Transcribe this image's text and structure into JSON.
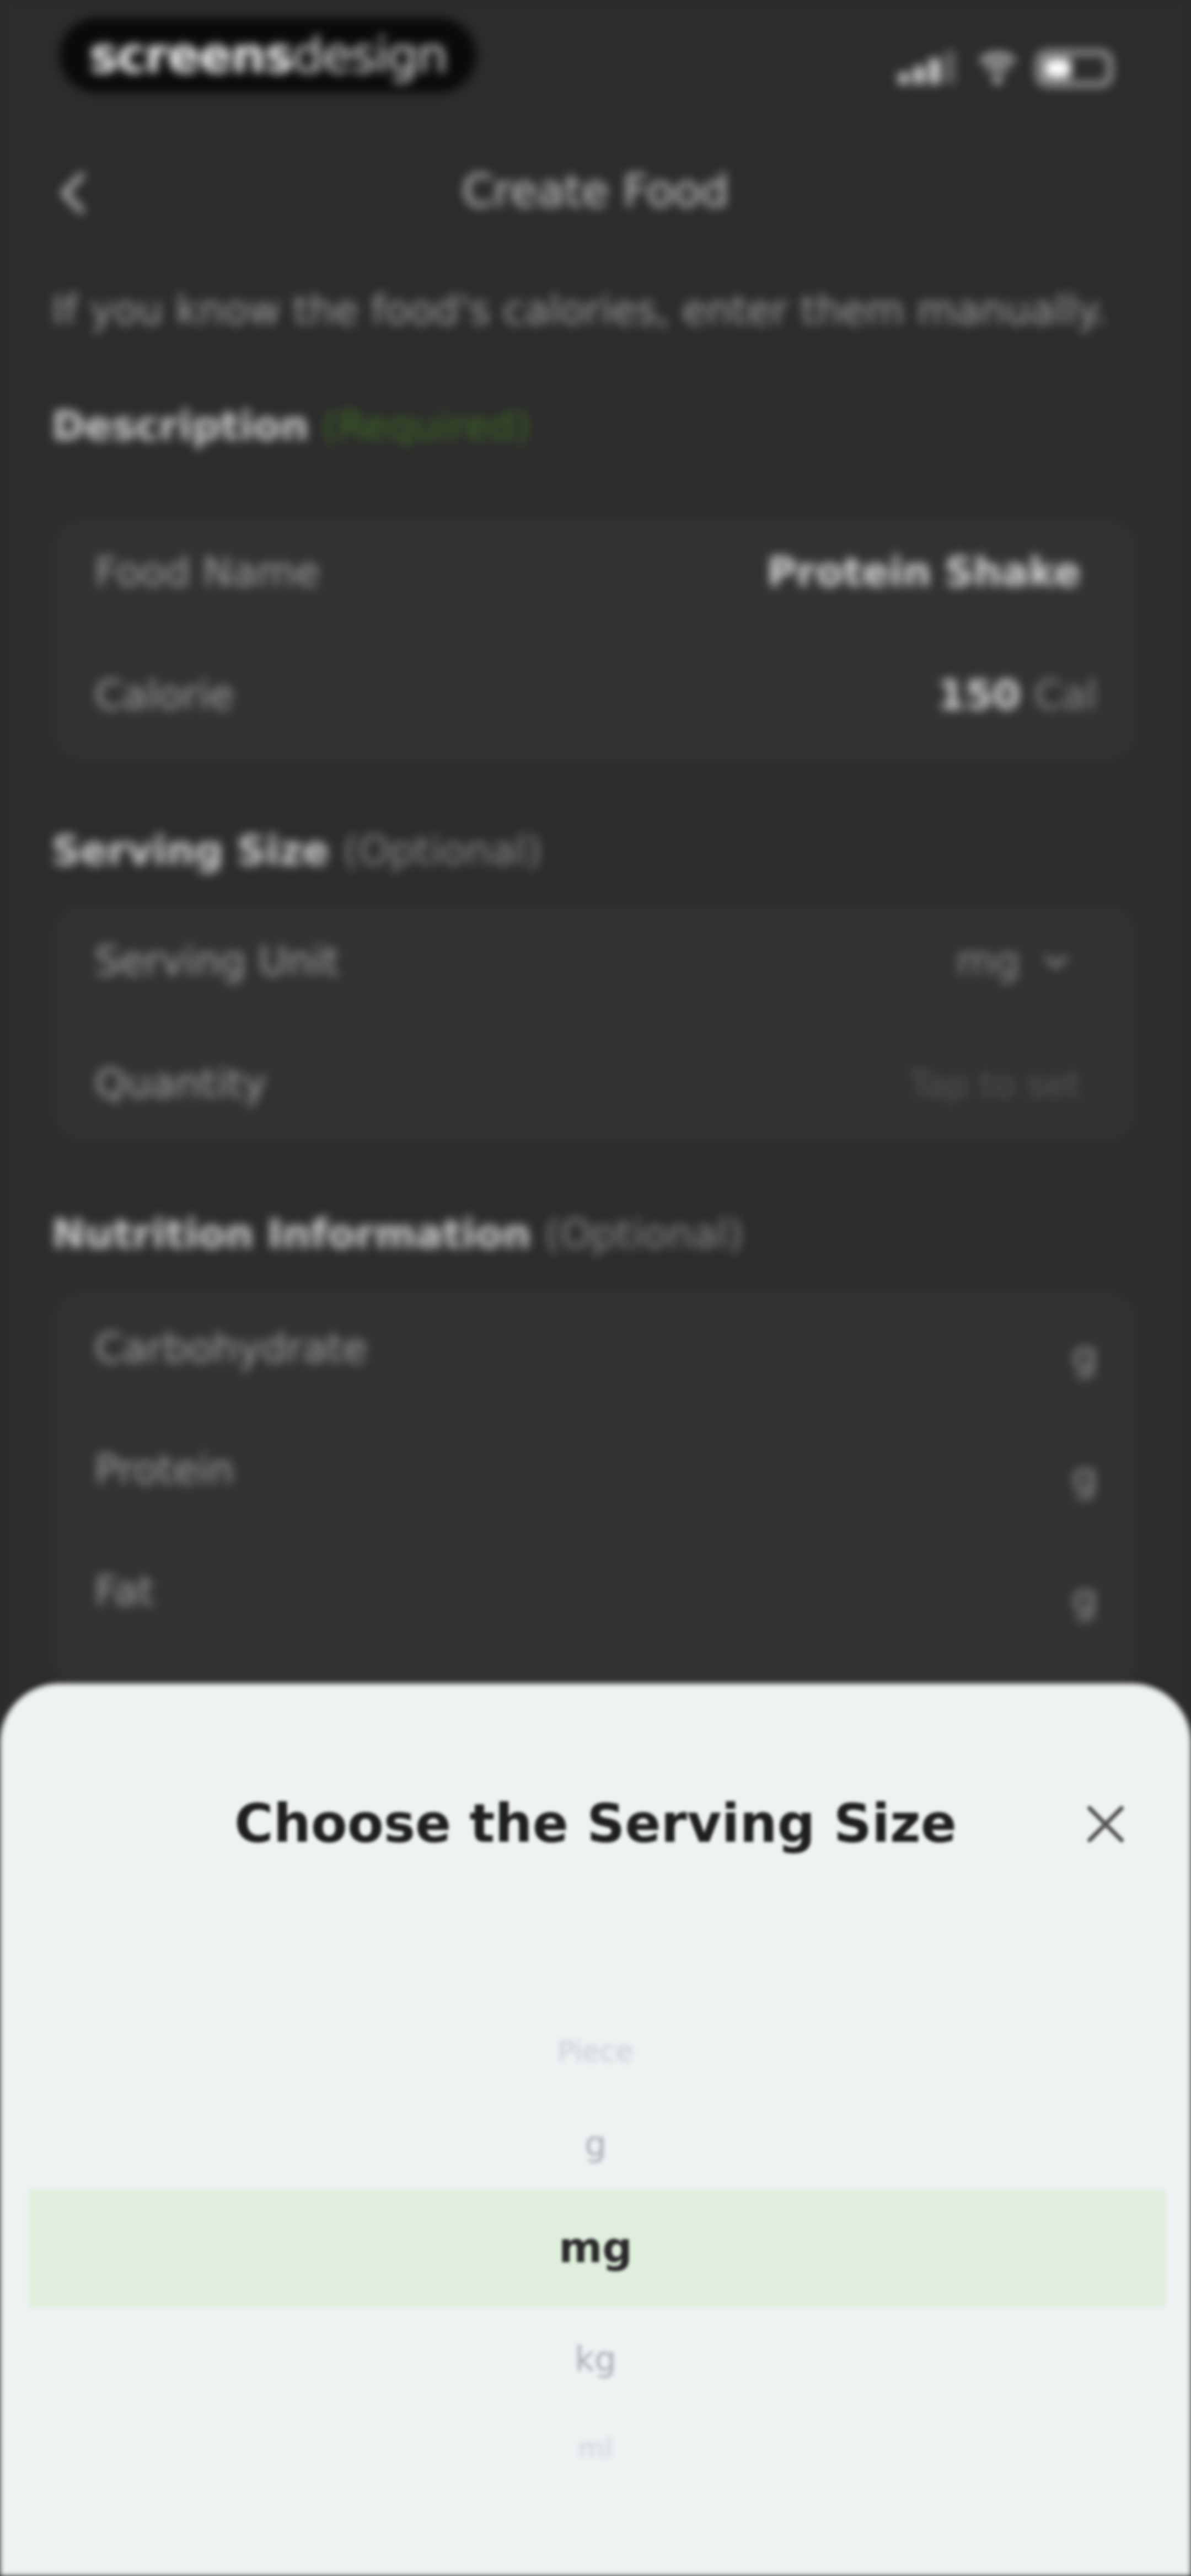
{
  "status_bar": {
    "logo_bold": "screens",
    "logo_light": "design"
  },
  "nav": {
    "back_icon": "chevron-left-icon",
    "title": "Create Food"
  },
  "intro_text": "If you know the food's calories, enter them manually.",
  "description_section": {
    "title": "Description",
    "qualifier": "(Required)",
    "rows": [
      {
        "label": "Food Name",
        "value": "Protein Shake",
        "unit": ""
      },
      {
        "label": "Calorie",
        "value": "150",
        "unit": "Cal"
      }
    ]
  },
  "serving_section": {
    "title": "Serving Size",
    "qualifier": "(Optional)",
    "rows": [
      {
        "label": "Serving Unit",
        "value": "mg",
        "icon": "chevron-down-icon"
      },
      {
        "label": "Quantity",
        "placeholder": "Tap to set"
      }
    ]
  },
  "nutrition_section": {
    "title": "Nutrition Information",
    "qualifier": "(Optional)",
    "rows": [
      {
        "label": "Carbohydrate",
        "unit": "g"
      },
      {
        "label": "Protein",
        "unit": "g"
      },
      {
        "label": "Fat",
        "unit": "g"
      }
    ]
  },
  "sheet": {
    "title": "Choose the Serving Size",
    "close_icon": "close-icon",
    "options": [
      "Piece",
      "g",
      "mg",
      "kg",
      "ml"
    ],
    "selected": "mg"
  },
  "colors": {
    "background": "#2c2c2c",
    "sheet": "#eef2f3",
    "selected_band": "#dfeedd",
    "required_green": "#3e6b22"
  }
}
